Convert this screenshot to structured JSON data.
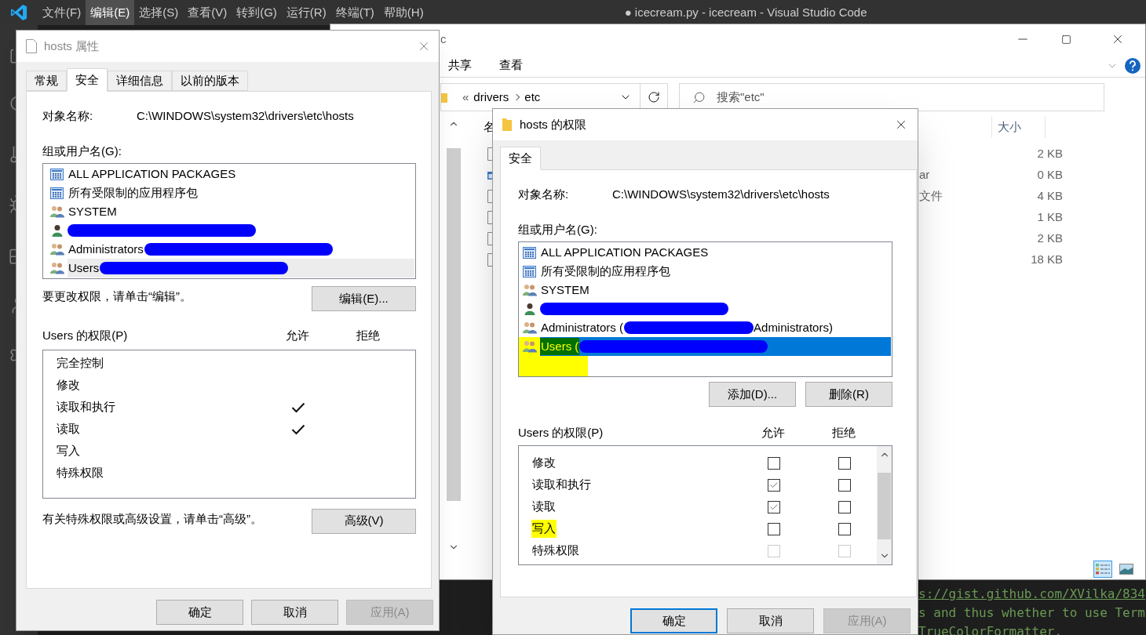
{
  "vscode": {
    "menu": [
      {
        "label": "文件(F)",
        "selected": false
      },
      {
        "label": "编辑(E)",
        "selected": true
      },
      {
        "label": "选择(S)",
        "selected": false
      },
      {
        "label": "查看(V)",
        "selected": false
      },
      {
        "label": "转到(G)",
        "selected": false
      },
      {
        "label": "运行(R)",
        "selected": false
      },
      {
        "label": "终端(T)",
        "selected": false
      },
      {
        "label": "帮助(H)",
        "selected": false
      }
    ],
    "title": "● icecream.py - icecream - Visual Studio Code",
    "terminal_lines": [
      {
        "text": "s://gist.github.com/XVilka/834",
        "link": true
      },
      {
        "text": "s and thus whether to use Term",
        "link": false
      },
      {
        "text": "TrueColorFormatter."
      }
    ]
  },
  "explorer": {
    "title": "c",
    "ribbon_tabs": [
      "共享",
      "查看"
    ],
    "address": {
      "overflow": "«",
      "crumbs": [
        "drivers",
        "etc"
      ]
    },
    "search": {
      "placeholder": "搜索\"etc\""
    },
    "columns": [
      "名",
      "大小"
    ],
    "rows": [
      {
        "kind": "file",
        "size": "2 KB"
      },
      {
        "kind": "app",
        "column_2": "ar",
        "size": "0 KB"
      },
      {
        "kind": "file",
        "column_2": "文件",
        "size": "4 KB"
      },
      {
        "kind": "file",
        "size": "1 KB"
      },
      {
        "kind": "file",
        "size": "2 KB"
      },
      {
        "kind": "file",
        "size": "18 KB"
      }
    ],
    "views": [
      {
        "kind": "details",
        "selected": true
      },
      {
        "kind": "preview",
        "selected": false
      }
    ]
  },
  "properties": {
    "title": "hosts 属性",
    "tabs": [
      {
        "label": "常规",
        "selected": false
      },
      {
        "label": "安全",
        "selected": true
      },
      {
        "label": "详细信息",
        "selected": false
      },
      {
        "label": "以前的版本",
        "selected": false
      }
    ],
    "object_label": "对象名称:",
    "object_path": "C:\\WINDOWS\\system32\\drivers\\etc\\hosts",
    "groups_label": "组或用户名(G):",
    "groups": [
      {
        "kind": "package",
        "name": "ALL APPLICATION PACKAGES",
        "redacted": false,
        "selected": false,
        "highlighted": false
      },
      {
        "kind": "package",
        "name": "所有受限制的应用程序包",
        "redacted": false,
        "selected": false,
        "highlighted": false
      },
      {
        "kind": "group",
        "name": "SYSTEM",
        "redacted": false,
        "selected": false,
        "highlighted": false
      },
      {
        "kind": "user",
        "redacted": true,
        "selected": false,
        "highlighted": false
      },
      {
        "kind": "group",
        "name": "Administrators",
        "redacted": true,
        "selected": false,
        "highlighted": false
      },
      {
        "kind": "group",
        "name": "Users",
        "redacted": true,
        "selected": true,
        "highlighted": false
      }
    ],
    "hint": "要更改权限，请单击“编辑”。",
    "hint_button": "编辑(E)...",
    "perm_label": "Users 的权限(P)",
    "allow_label": "允许",
    "deny_label": "拒绝",
    "permissions": [
      {
        "name": "完全控制",
        "allow": false,
        "deny": false,
        "highlighted": false
      },
      {
        "name": "修改",
        "allow": false,
        "deny": false,
        "highlighted": false
      },
      {
        "name": "读取和执行",
        "allow": true,
        "deny": false,
        "highlighted": false
      },
      {
        "name": "读取",
        "allow": true,
        "deny": false,
        "highlighted": false
      },
      {
        "name": "写入",
        "allow": false,
        "deny": false,
        "highlighted": false
      },
      {
        "name": "特殊权限",
        "allow": false,
        "deny": false,
        "highlighted": false
      }
    ],
    "advanced_hint": "有关特殊权限或高级设置，请单击“高级”。",
    "advanced_button": "高级(V)",
    "buttons": [
      {
        "label": "确定",
        "disabled": false,
        "default": false
      },
      {
        "label": "取消",
        "disabled": false,
        "default": false
      },
      {
        "label": "应用(A)",
        "disabled": true,
        "default": false
      }
    ]
  },
  "permissions_dialog": {
    "title": "hosts 的权限",
    "tabs": [
      {
        "label": "安全",
        "selected": true
      }
    ],
    "object_label": "对象名称:",
    "object_path": "C:\\WINDOWS\\system32\\drivers\\etc\\hosts",
    "groups_label": "组或用户名(G):",
    "groups": [
      {
        "kind": "package",
        "name": "ALL APPLICATION PACKAGES",
        "redacted": false,
        "selected": false,
        "highlighted": false
      },
      {
        "kind": "package",
        "name": "所有受限制的应用程序包",
        "redacted": false,
        "selected": false,
        "highlighted": false
      },
      {
        "kind": "group",
        "name": "SYSTEM",
        "redacted": false,
        "selected": false,
        "highlighted": false
      },
      {
        "kind": "user",
        "redacted": true,
        "selected": false,
        "highlighted": false
      },
      {
        "kind": "group",
        "name": "Administrators (",
        "redacted": true,
        "suffix": "Administrators)",
        "selected": false,
        "highlighted": false
      },
      {
        "kind": "group",
        "name": "Users (",
        "redacted": true,
        "selected": true,
        "highlighted": true
      }
    ],
    "group_buttons": [
      "添加(D)...",
      "删除(R)"
    ],
    "perm_label": "Users 的权限(P)",
    "allow_label": "允许",
    "deny_label": "拒绝",
    "permissions": [
      {
        "name": "修改",
        "allow": {
          "checked": false,
          "disabled": false
        },
        "deny": {
          "checked": false,
          "disabled": false
        },
        "highlighted": false
      },
      {
        "name": "读取和执行",
        "allow": {
          "checked": true,
          "disabled": false
        },
        "deny": {
          "checked": false,
          "disabled": false
        },
        "highlighted": false
      },
      {
        "name": "读取",
        "allow": {
          "checked": true,
          "disabled": false
        },
        "deny": {
          "checked": false,
          "disabled": false
        },
        "highlighted": false
      },
      {
        "name": "写入",
        "allow": {
          "checked": false,
          "disabled": false
        },
        "deny": {
          "checked": false,
          "disabled": false
        },
        "highlighted": true
      },
      {
        "name": "特殊权限",
        "allow": {
          "checked": false,
          "disabled": true
        },
        "deny": {
          "checked": false,
          "disabled": true
        },
        "highlighted": false
      }
    ],
    "buttons": [
      {
        "label": "确定",
        "disabled": false,
        "default": true
      },
      {
        "label": "取消",
        "disabled": false,
        "default": false
      },
      {
        "label": "应用(A)",
        "disabled": true,
        "default": false
      }
    ]
  }
}
